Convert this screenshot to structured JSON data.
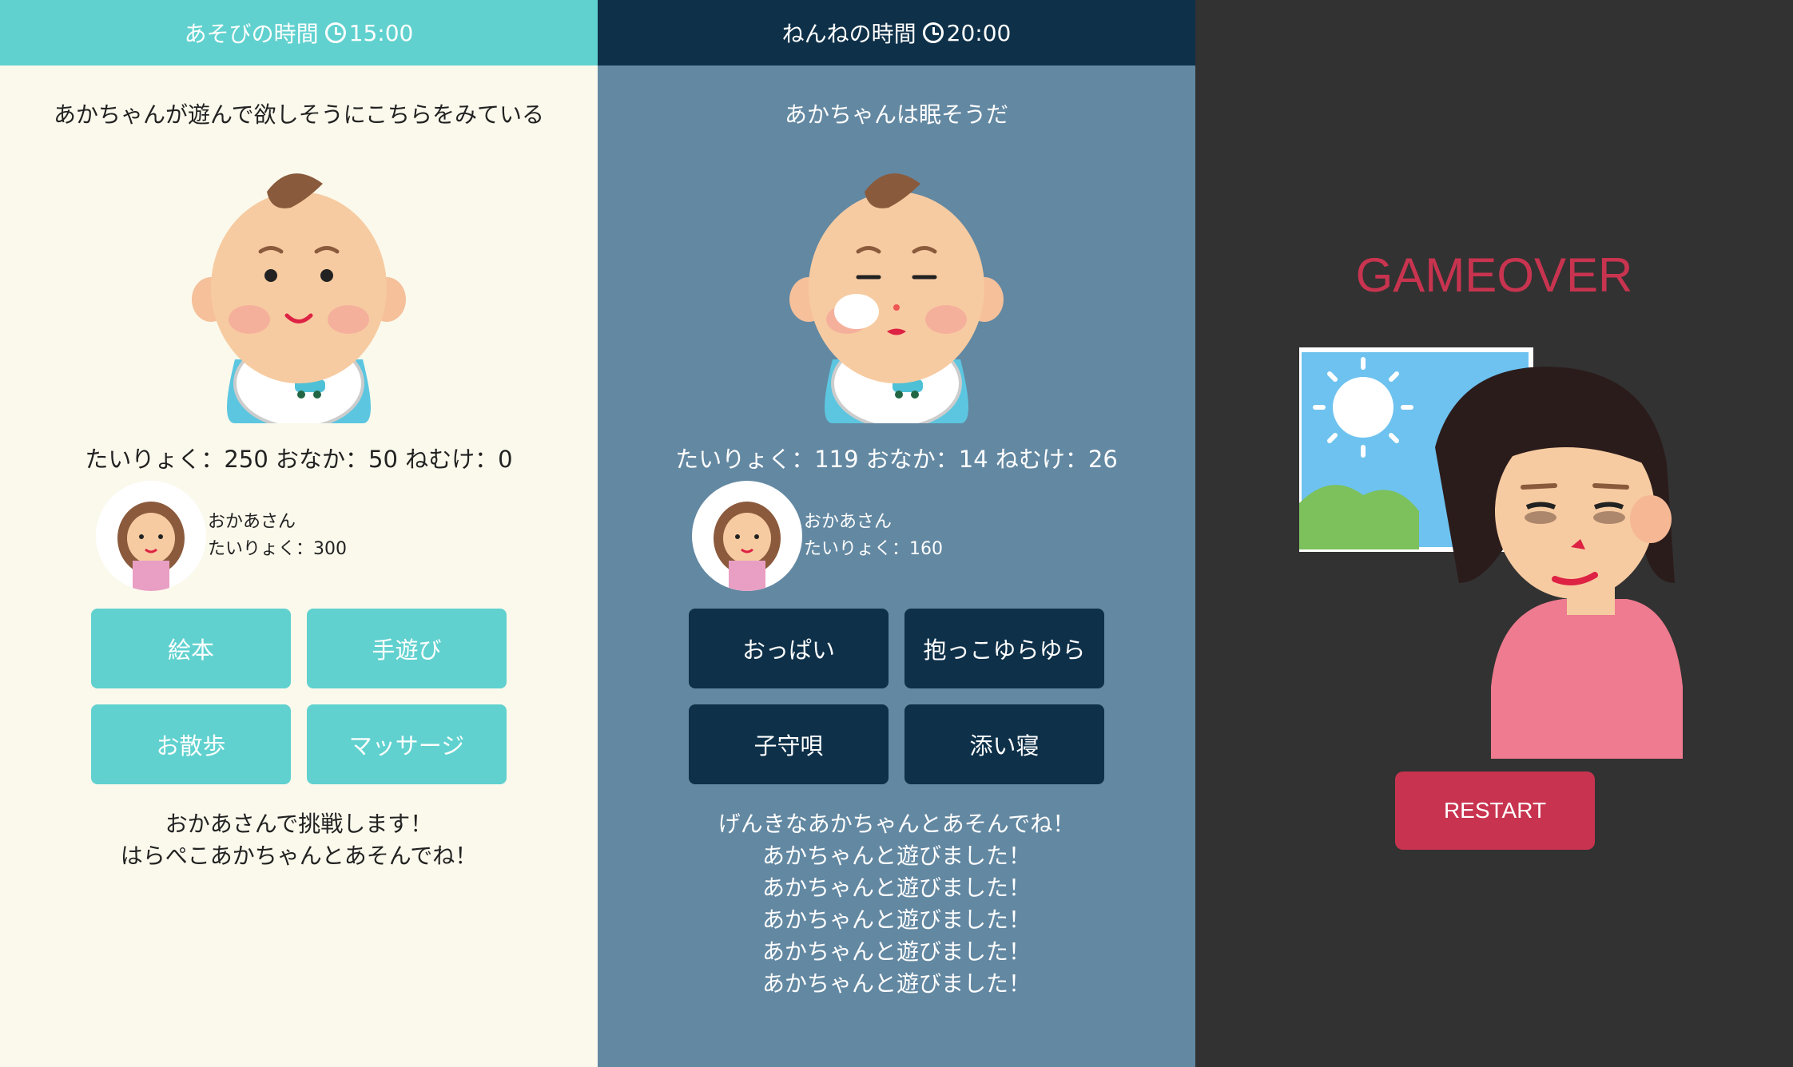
{
  "panels": [
    {
      "header": {
        "title": "あそびの時間",
        "time": "15:00"
      },
      "message": "あかちゃんが遊んで欲しそうにこちらをみている",
      "baby_state": "smiling",
      "stats": "たいりょく：250 おなか：50 ねむけ：0",
      "mother": {
        "name": "おかあさん",
        "stamina": "たいりょく：300"
      },
      "buttons": [
        "絵本",
        "手遊び",
        "お散歩",
        "マッサージ"
      ],
      "log": [
        "おかあさんで挑戦します！",
        "はらぺこあかちゃんとあそんでね！"
      ]
    },
    {
      "header": {
        "title": "ねんねの時間",
        "time": "20:00"
      },
      "message": "あかちゃんは眠そうだ",
      "baby_state": "sleepy",
      "stats": "たいりょく：119 おなか：14 ねむけ：26",
      "mother": {
        "name": "おかあさん",
        "stamina": "たいりょく：160"
      },
      "buttons": [
        "おっぱい",
        "抱っこゆらゆら",
        "子守唄",
        "添い寝"
      ],
      "log": [
        "げんきなあかちゃんとあそんでね！",
        "あかちゃんと遊びました！",
        "あかちゃんと遊びました！",
        "あかちゃんと遊びました！",
        "あかちゃんと遊びました！",
        "あかちゃんと遊びました！"
      ]
    }
  ],
  "gameover": {
    "title": "GAMEOVER",
    "restart_label": "RESTART"
  },
  "colors": {
    "play_accent": "#60d1cf",
    "night_dark": "#0e3049",
    "night_bg": "#6388a2",
    "cream_bg": "#fbf9ec",
    "gameover_red": "#c8344f",
    "dark_bg": "#323232"
  },
  "icons": {
    "clock": "clock-icon"
  }
}
